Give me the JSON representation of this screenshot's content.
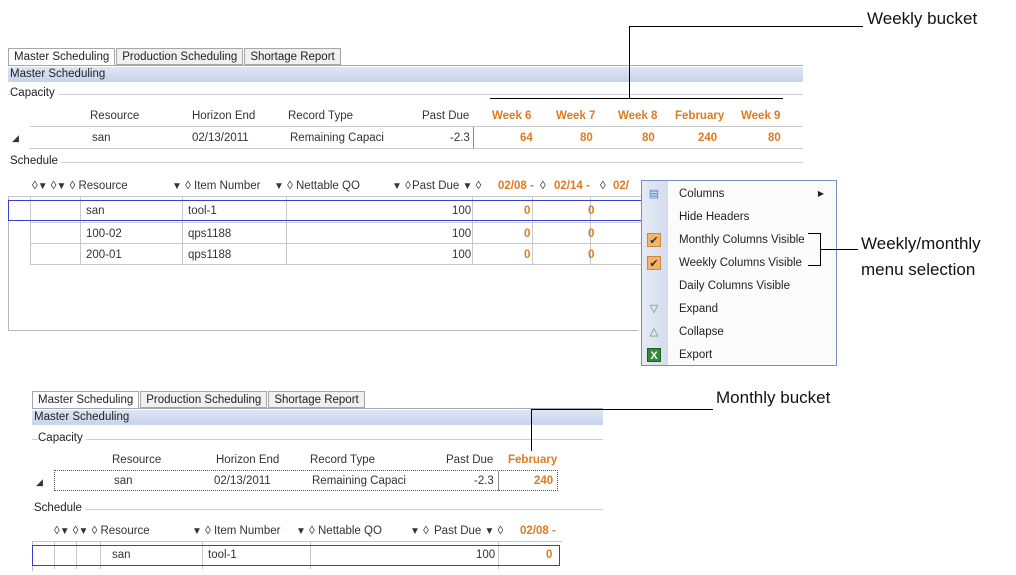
{
  "annotations": {
    "weekly": "Weekly bucket",
    "menu_line1": "Weekly/monthly",
    "menu_line2": "menu selection",
    "monthly": "Monthly bucket"
  },
  "top": {
    "tabs": [
      "Master Scheduling",
      "Production Scheduling",
      "Shortage Report"
    ],
    "title": "Master Scheduling",
    "capacity_label": "Capacity",
    "capacity_headers": [
      "Resource",
      "Horizon End",
      "Record Type",
      "Past Due",
      "Week 6",
      "Week 7",
      "Week 8",
      "February",
      "Week 9"
    ],
    "capacity_row": {
      "resource": "san",
      "horizon": "02/13/2011",
      "type": "Remaining Capaci",
      "past_due": "-2.3",
      "w6": "64",
      "w7": "80",
      "w8": "80",
      "feb": "240",
      "w9": "80"
    },
    "schedule_label": "Schedule",
    "schedule_headers": {
      "resource": "Resource",
      "item": "Item Number",
      "nettable": "Nettable QO",
      "past_due": "Past Due",
      "d1": "02/08 -",
      "d2": "02/14 -",
      "d3": "02/"
    },
    "schedule_rows": [
      {
        "resource": "san",
        "item": "tool-1",
        "past_due": "100",
        "d1": "0",
        "d2": "0"
      },
      {
        "resource": "100-02",
        "item": "qps1188",
        "past_due": "100",
        "d1": "0",
        "d2": "0"
      },
      {
        "resource": "200-01",
        "item": "qps1188",
        "past_due": "100",
        "d1": "0",
        "d2": "0"
      }
    ]
  },
  "menu": {
    "items": [
      "Columns",
      "Hide Headers",
      "Monthly Columns Visible",
      "Weekly Columns Visible",
      "Daily Columns Visible",
      "Expand",
      "Collapse",
      "Export"
    ]
  },
  "bottom": {
    "tabs": [
      "Master Scheduling",
      "Production Scheduling",
      "Shortage Report"
    ],
    "title": "Master Scheduling",
    "capacity_label": "Capacity",
    "capacity_headers": [
      "Resource",
      "Horizon End",
      "Record Type",
      "Past Due",
      "February"
    ],
    "capacity_row": {
      "resource": "san",
      "horizon": "02/13/2011",
      "type": "Remaining Capaci",
      "past_due": "-2.3",
      "feb": "240"
    },
    "schedule_label": "Schedule",
    "schedule_headers": {
      "resource": "Resource",
      "item": "Item Number",
      "nettable": "Nettable QO",
      "past_due": "Past Due",
      "d1": "02/08 -"
    },
    "schedule_row": {
      "resource": "san",
      "item": "tool-1",
      "past_due": "100",
      "d1": "0"
    }
  }
}
